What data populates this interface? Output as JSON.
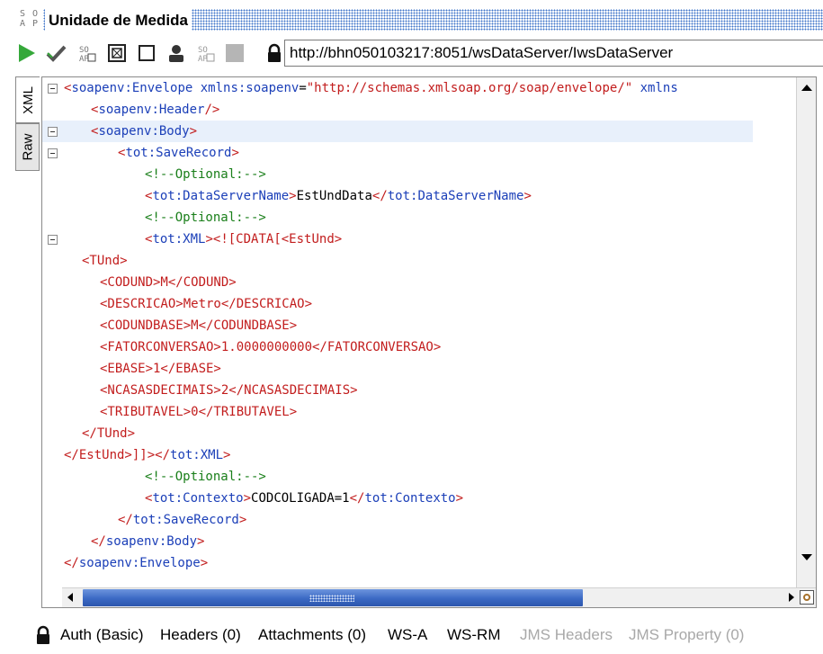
{
  "window": {
    "logo_text": "SO\nAP",
    "title": "Unidade de Medida"
  },
  "toolbar": {
    "url": "http://bhn050103217:8051/wsDataServer/IwsDataServer",
    "icons": [
      "run-icon",
      "validate-icon",
      "soap-request-icon",
      "maximize-icon",
      "square-icon",
      "user-icon",
      "soap-response-icon",
      "stop-icon",
      "lock-icon"
    ]
  },
  "side_tabs": {
    "xml": "XML",
    "raw": "Raw"
  },
  "editor": {
    "lines": [
      [
        [
          "r",
          "<"
        ],
        [
          "b",
          "soapenv:Envelope"
        ],
        [
          "k",
          " "
        ],
        [
          "b",
          "xmlns:soapenv"
        ],
        [
          "k",
          "="
        ],
        [
          "r",
          "\"http://schemas.xmlsoap.org/soap/envelope/\""
        ],
        [
          "k",
          " "
        ],
        [
          "b",
          "xmlns"
        ]
      ],
      [
        [
          "r",
          "<"
        ],
        [
          "b",
          "soapenv:Header"
        ],
        [
          "r",
          "/>"
        ]
      ],
      [
        [
          "r",
          "<"
        ],
        [
          "b",
          "soapenv:Body"
        ],
        [
          "r",
          ">"
        ]
      ],
      [
        [
          "r",
          "<"
        ],
        [
          "b",
          "tot:SaveRecord"
        ],
        [
          "r",
          ">"
        ]
      ],
      [
        [
          "g",
          "<!--Optional:-->"
        ]
      ],
      [
        [
          "r",
          "<"
        ],
        [
          "b",
          "tot:DataServerName"
        ],
        [
          "r",
          ">"
        ],
        [
          "k",
          "EstUndData"
        ],
        [
          "r",
          "</"
        ],
        [
          "b",
          "tot:DataServerName"
        ],
        [
          "r",
          ">"
        ]
      ],
      [
        [
          "g",
          "<!--Optional:-->"
        ]
      ],
      [
        [
          "r",
          "<"
        ],
        [
          "b",
          "tot:XML"
        ],
        [
          "r",
          ">"
        ],
        [
          "r",
          "<![CDATA[<EstUnd>"
        ]
      ],
      [
        [
          "r",
          "<TUnd>"
        ]
      ],
      [
        [
          "r",
          "<CODUND>M</CODUND>"
        ]
      ],
      [
        [
          "r",
          "<DESCRICAO>Metro</DESCRICAO>"
        ]
      ],
      [
        [
          "r",
          "<CODUNDBASE>M</CODUNDBASE>"
        ]
      ],
      [
        [
          "r",
          "<FATORCONVERSAO>1.0000000000</FATORCONVERSAO>"
        ]
      ],
      [
        [
          "r",
          "<EBASE>1</EBASE>"
        ]
      ],
      [
        [
          "r",
          "<NCASASDECIMAIS>2</NCASASDECIMAIS>"
        ]
      ],
      [
        [
          "r",
          "<TRIBUTAVEL>0</TRIBUTAVEL>"
        ]
      ],
      [
        [
          "r",
          "</TUnd>"
        ]
      ],
      [
        [
          "r",
          "</EstUnd>]]>"
        ],
        [
          "r",
          "</"
        ],
        [
          "b",
          "tot:XML"
        ],
        [
          "r",
          ">"
        ]
      ],
      [
        [
          "g",
          "<!--Optional:-->"
        ]
      ],
      [
        [
          "r",
          "<"
        ],
        [
          "b",
          "tot:Contexto"
        ],
        [
          "r",
          ">"
        ],
        [
          "k",
          "CODCOLIGADA=1"
        ],
        [
          "r",
          "</"
        ],
        [
          "b",
          "tot:Contexto"
        ],
        [
          "r",
          ">"
        ]
      ],
      [
        [
          "r",
          "</"
        ],
        [
          "b",
          "tot:SaveRecord"
        ],
        [
          "r",
          ">"
        ]
      ],
      [
        [
          "r",
          "</"
        ],
        [
          "b",
          "soapenv:Body"
        ],
        [
          "r",
          ">"
        ]
      ],
      [
        [
          "r",
          "</"
        ],
        [
          "b",
          "soapenv:Envelope"
        ],
        [
          "r",
          ">"
        ]
      ]
    ]
  },
  "bottom_tabs": [
    {
      "label": "Auth (Basic)",
      "enabled": true
    },
    {
      "label": "Headers (0)",
      "enabled": true
    },
    {
      "label": "Attachments (0)",
      "enabled": true
    },
    {
      "label": "WS-A",
      "enabled": true
    },
    {
      "label": "WS-RM",
      "enabled": true
    },
    {
      "label": "JMS Headers",
      "enabled": false
    },
    {
      "label": "JMS Property (0)",
      "enabled": false
    }
  ]
}
